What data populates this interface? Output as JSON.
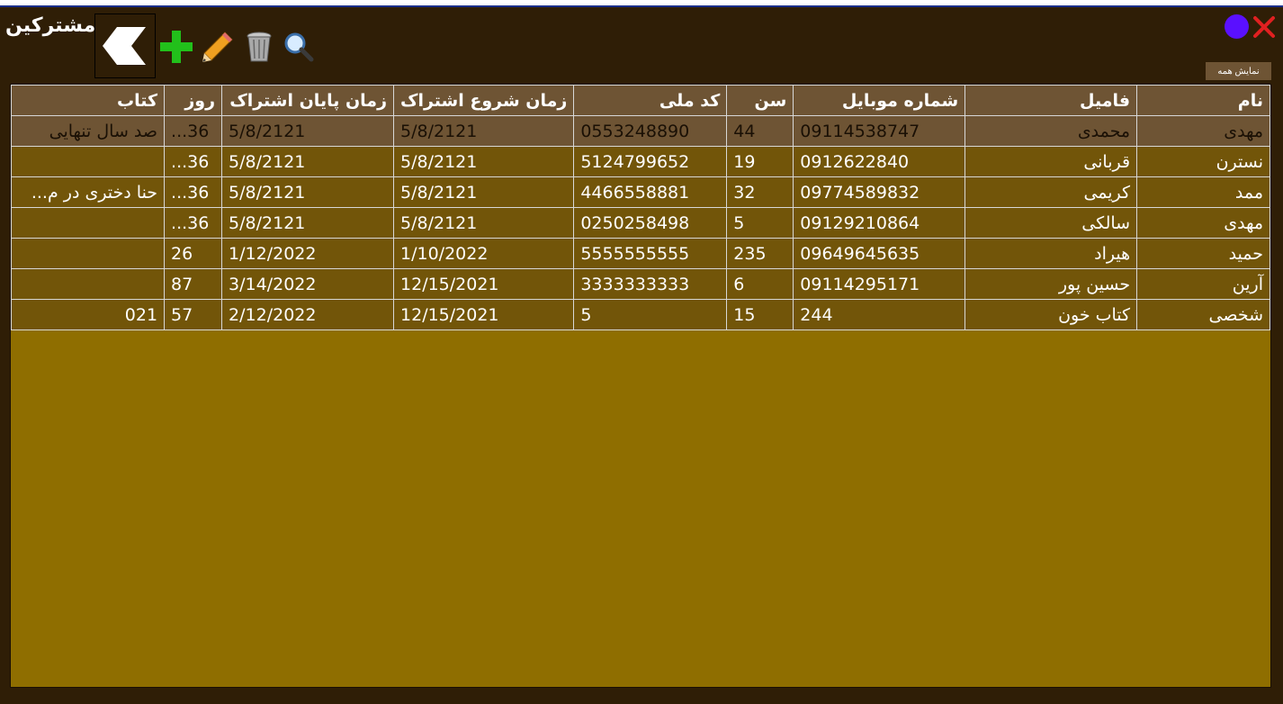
{
  "window": {
    "title": "مشترکین",
    "show_all_label": "نمایش همه"
  },
  "toolbar": {
    "icons": [
      "back-arrow-icon",
      "add-icon",
      "edit-pencil-icon",
      "trash-icon",
      "search-icon"
    ]
  },
  "colors": {
    "window_bg": "#2f1e06",
    "grid_bg": "#8f6e00",
    "header_bg": "#6e5434",
    "row_bg": "#725509",
    "add_green": "#22c01b",
    "close_red": "#e02020",
    "status_purple": "#5a10ff"
  },
  "table": {
    "headers": [
      "نام",
      "فامیل",
      "شماره موبایل",
      "سن",
      "کد ملی",
      "زمان شروع اشتراک",
      "زمان پایان اشتراک",
      "روز",
      "کتاب"
    ],
    "rows": [
      [
        "مهدی",
        "محمدی",
        "09114538747",
        "44",
        "0553248890",
        "5/8/2121",
        "5/8/2121",
        "36...",
        "صد سال تنهایی"
      ],
      [
        "نسترن",
        "قربانی",
        "0912622840",
        "19",
        "5124799652",
        "5/8/2121",
        "5/8/2121",
        "36...",
        ""
      ],
      [
        "ممد",
        "کریمی",
        "09774589832",
        "32",
        "4466558881",
        "5/8/2121",
        "5/8/2121",
        "36...",
        "حنا دختری در م..."
      ],
      [
        "مهدی",
        "سالکی",
        "09129210864",
        "5",
        "0250258498",
        "5/8/2121",
        "5/8/2121",
        "36...",
        ""
      ],
      [
        "حمید",
        "هیراد",
        "09649645635",
        "235",
        "5555555555",
        "1/10/2022",
        "1/12/2022",
        "26",
        ""
      ],
      [
        "آرین",
        "حسین پور",
        "09114295171",
        "6",
        "3333333333",
        "12/15/2021",
        "3/14/2022",
        "87",
        ""
      ],
      [
        "شخصی",
        "کتاب خون",
        "244",
        "15",
        "5",
        "12/15/2021",
        "2/12/2022",
        "57",
        "021"
      ]
    ]
  }
}
